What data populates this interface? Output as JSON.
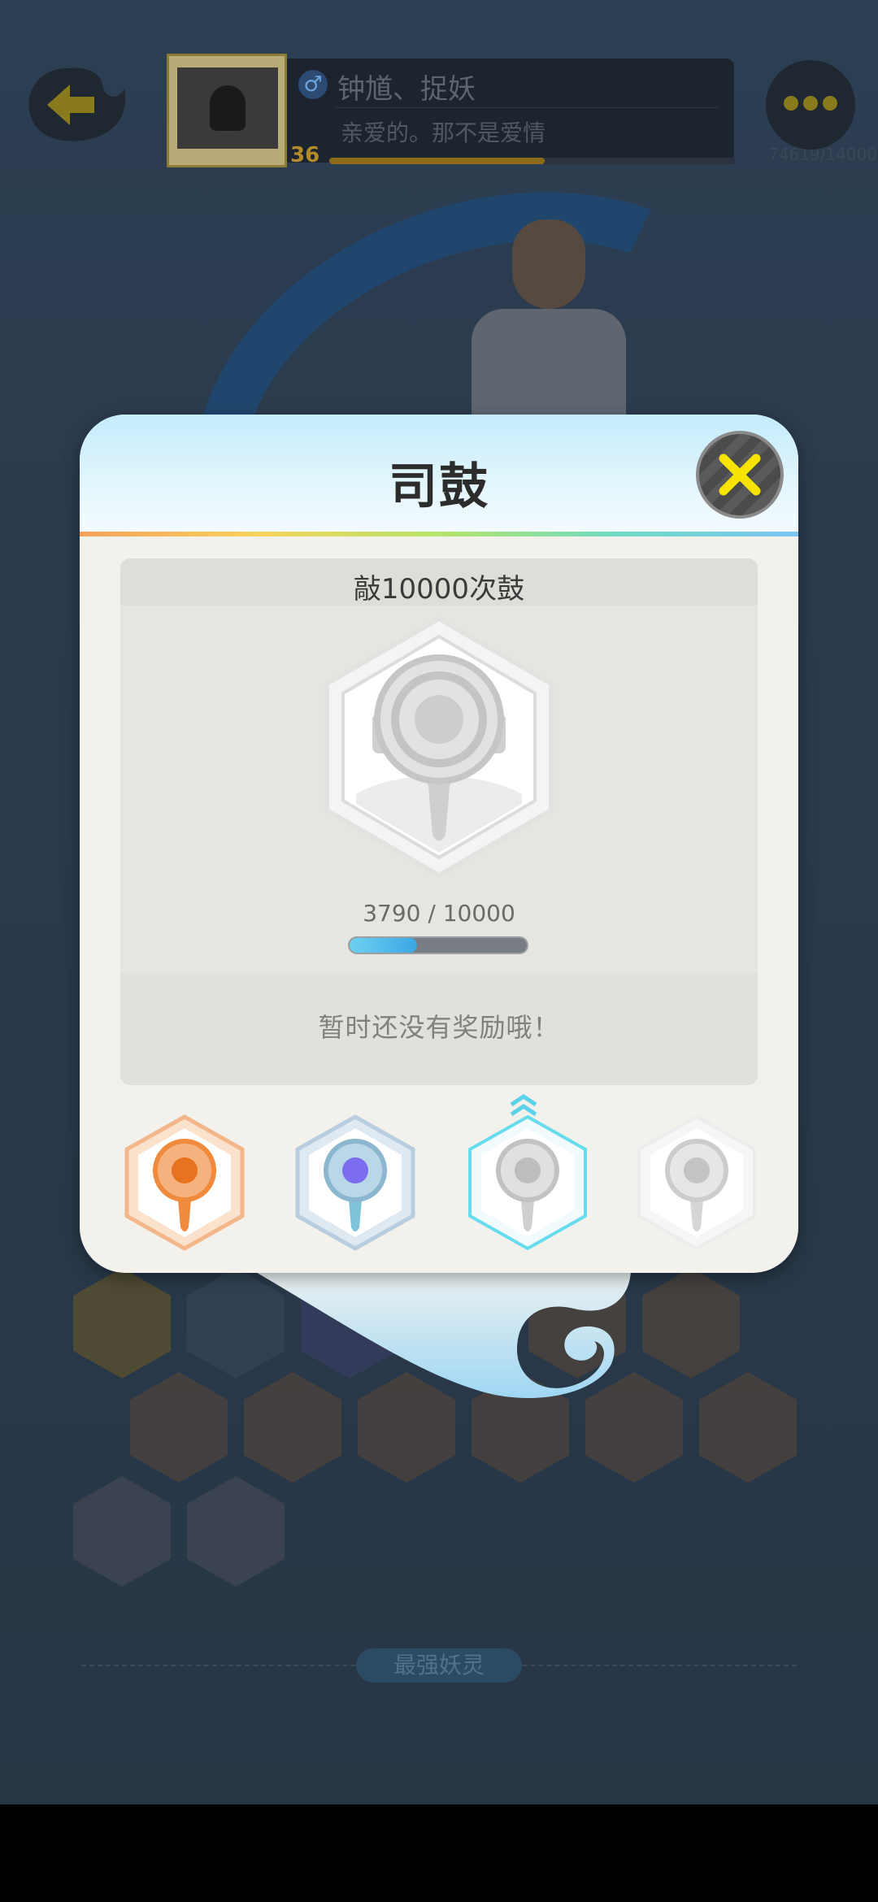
{
  "header": {
    "name": "钟馗、捉妖",
    "motto": "亲爱的。那不是爱情",
    "level": "36",
    "xp_text": "74619/140000",
    "gender_symbol": "♂"
  },
  "modal": {
    "title": "司鼓",
    "subtitle": "敲10000次鼓",
    "progress_text": "3790 / 10000",
    "progress_value": 3790,
    "progress_max": 10000,
    "reward_text": "暂时还没有奖励哦！"
  },
  "tiers": [
    {
      "name": "bronze",
      "color": "#f08a3c"
    },
    {
      "name": "silver-blue",
      "color": "#7b6cf0"
    },
    {
      "name": "current-locked",
      "color": "#b8b8b8"
    },
    {
      "name": "locked",
      "color": "#c8c8c8"
    }
  ],
  "footer": {
    "section_label": "最强妖灵"
  },
  "colors": {
    "accent_yellow": "#f6e400",
    "progress_blue": "#3aa7e4"
  }
}
